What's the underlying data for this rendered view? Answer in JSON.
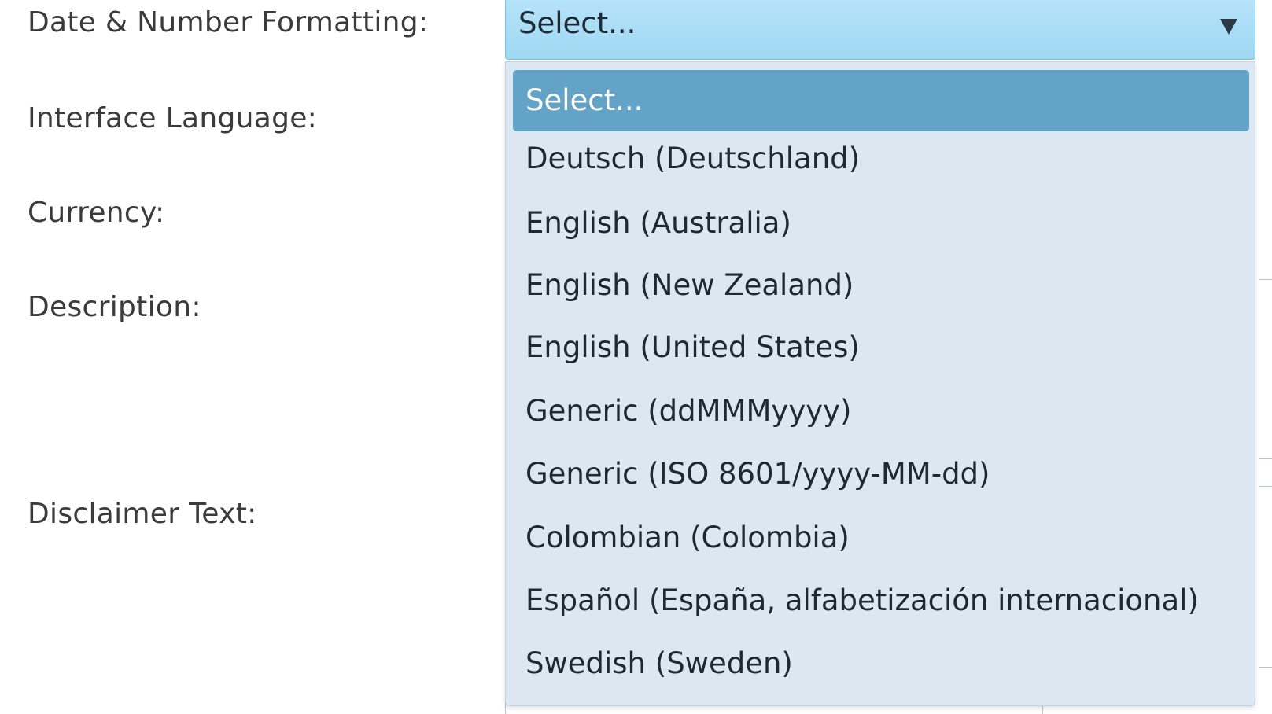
{
  "form": {
    "labels": {
      "date_number_formatting": "Date & Number Formatting:",
      "interface_language": "Interface Language:",
      "currency": "Currency:",
      "description": "Description:",
      "disclaimer_text": "Disclaimer Text:"
    }
  },
  "date_format_select": {
    "selected_value": "Select...",
    "options": [
      "Select...",
      "Deutsch (Deutschland)",
      "English (Australia)",
      "English (New Zealand)",
      "English (United States)",
      "Generic (ddMMMyyyy)",
      "Generic (ISO 8601/yyyy-MM-dd)",
      "Colombian (Colombia)",
      "Español (España, alfabetización internacional)",
      "Swedish (Sweden)"
    ],
    "highlighted_index": 0
  },
  "colors": {
    "select_background": "#aadcf5",
    "dropdown_background": "#dbe8f2",
    "highlight": "#62a3c7",
    "label_text": "#3b3b3b"
  },
  "icons": {
    "select_arrow": "caret-down-icon"
  }
}
